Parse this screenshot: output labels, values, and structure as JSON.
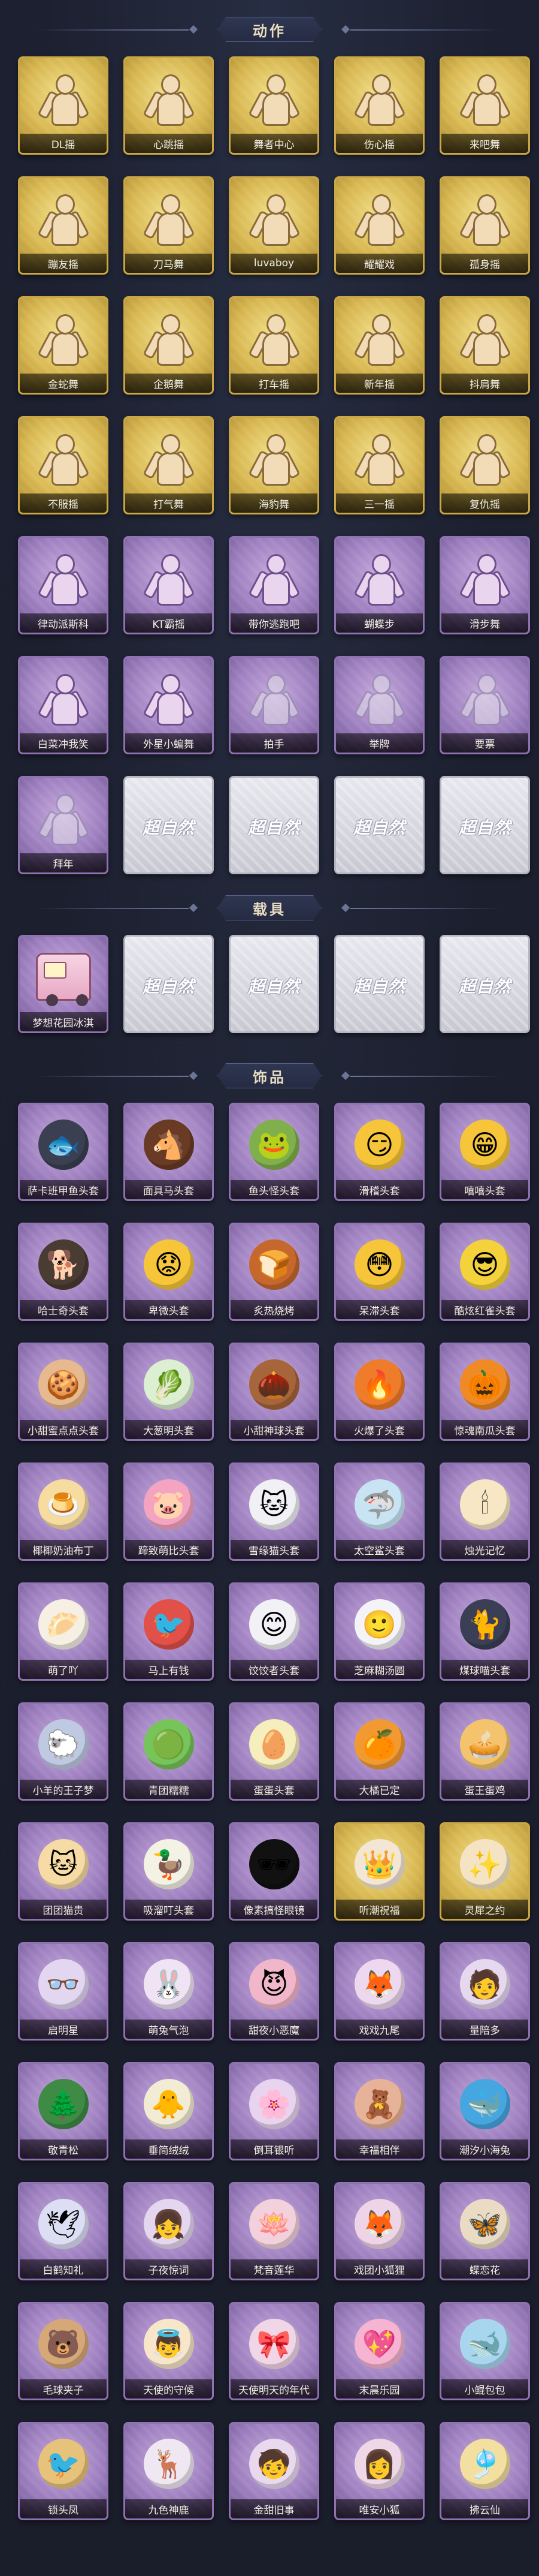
{
  "sections": [
    {
      "title": "动作",
      "items": [
        {
          "label": "DL摇",
          "style": "gold",
          "icon": "dance-figure-icon"
        },
        {
          "label": "心跳摇",
          "style": "gold",
          "icon": "dance-figure-icon"
        },
        {
          "label": "舞者中心",
          "style": "gold",
          "icon": "dance-figure-icon"
        },
        {
          "label": "伤心摇",
          "style": "gold",
          "icon": "dance-figure-icon"
        },
        {
          "label": "来吧舞",
          "style": "gold",
          "icon": "dance-figure-icon"
        },
        {
          "label": "蹦友摇",
          "style": "gold",
          "icon": "dance-figure-icon"
        },
        {
          "label": "刀马舞",
          "style": "gold",
          "icon": "dance-figure-icon"
        },
        {
          "label": "luvaboy",
          "style": "gold",
          "icon": "dance-figure-icon"
        },
        {
          "label": "耀耀戏",
          "style": "gold",
          "icon": "dance-figure-icon"
        },
        {
          "label": "孤身摇",
          "style": "gold",
          "icon": "dance-figure-icon"
        },
        {
          "label": "金蛇舞",
          "style": "gold",
          "icon": "dance-figure-icon"
        },
        {
          "label": "企鹅舞",
          "style": "gold",
          "icon": "dance-figure-icon"
        },
        {
          "label": "打车摇",
          "style": "gold",
          "icon": "dance-figure-icon"
        },
        {
          "label": "新年摇",
          "style": "gold",
          "icon": "dance-figure-icon"
        },
        {
          "label": "抖肩舞",
          "style": "gold",
          "icon": "dance-figure-icon"
        },
        {
          "label": "不服摇",
          "style": "gold",
          "icon": "dance-figure-icon"
        },
        {
          "label": "打气舞",
          "style": "gold",
          "icon": "dance-figure-icon"
        },
        {
          "label": "海豹舞",
          "style": "gold",
          "icon": "dance-figure-icon"
        },
        {
          "label": "三一摇",
          "style": "gold",
          "icon": "dance-figure-icon"
        },
        {
          "label": "复仇摇",
          "style": "gold",
          "icon": "dance-figure-icon"
        },
        {
          "label": "律动派斯科",
          "style": "purple",
          "icon": "dance-figure-icon"
        },
        {
          "label": "KT霸摇",
          "style": "purple",
          "icon": "dance-figure-icon"
        },
        {
          "label": "带你逃跑吧",
          "style": "purple",
          "icon": "dance-figure-icon"
        },
        {
          "label": "蝴蝶步",
          "style": "purple",
          "icon": "dance-figure-icon"
        },
        {
          "label": "滑步舞",
          "style": "purple",
          "icon": "dance-figure-icon"
        },
        {
          "label": "白菜冲我笑",
          "style": "purple",
          "icon": "dance-figure-icon"
        },
        {
          "label": "外星小蝙舞",
          "style": "purple",
          "icon": "dance-figure-icon"
        },
        {
          "label": "拍手",
          "style": "purple-faded",
          "icon": "dance-figure-icon"
        },
        {
          "label": "举牌",
          "style": "purple-faded",
          "icon": "dance-figure-icon"
        },
        {
          "label": "要票",
          "style": "purple-faded",
          "icon": "dance-figure-icon"
        },
        {
          "label": "拜年",
          "style": "purple-faded",
          "icon": "dance-figure-icon"
        },
        {
          "label": "",
          "style": "locked",
          "icon": "brand-watermark"
        },
        {
          "label": "",
          "style": "locked",
          "icon": "brand-watermark"
        },
        {
          "label": "",
          "style": "locked",
          "icon": "brand-watermark"
        },
        {
          "label": "",
          "style": "locked",
          "icon": "brand-watermark"
        }
      ]
    },
    {
      "title": "载具",
      "items": [
        {
          "label": "梦想花园冰淇",
          "style": "purple",
          "icon": "ice-cream-truck-icon"
        },
        {
          "label": "",
          "style": "locked",
          "icon": "brand-watermark"
        },
        {
          "label": "",
          "style": "locked",
          "icon": "brand-watermark"
        },
        {
          "label": "",
          "style": "locked",
          "icon": "brand-watermark"
        },
        {
          "label": "",
          "style": "locked",
          "icon": "brand-watermark"
        }
      ]
    },
    {
      "title": "饰品",
      "items": [
        {
          "label": "萨卡班甲鱼头套",
          "style": "purple",
          "icon": "fish-head-icon",
          "glyph": "🐟",
          "color": "#3b3f52"
        },
        {
          "label": "面具马头套",
          "style": "purple",
          "icon": "horse-head-icon",
          "glyph": "🐴",
          "color": "#6a3b24"
        },
        {
          "label": "鱼头怪头套",
          "style": "purple",
          "icon": "fish-monster-icon",
          "glyph": "🐸",
          "color": "#7fb04b"
        },
        {
          "label": "滑稽头套",
          "style": "purple",
          "icon": "smirk-face-icon",
          "glyph": "😏",
          "color": "#f6c53a"
        },
        {
          "label": "嘻嘻头套",
          "style": "purple",
          "icon": "grin-face-icon",
          "glyph": "😁",
          "color": "#f6c53a"
        },
        {
          "label": "哈士奇头套",
          "style": "purple",
          "icon": "husky-head-icon",
          "glyph": "🐕",
          "color": "#4a3b33"
        },
        {
          "label": "卑微头套",
          "style": "purple",
          "icon": "sad-face-icon",
          "glyph": "😟",
          "color": "#f6c53a"
        },
        {
          "label": "炙热烧烤",
          "style": "purple",
          "icon": "toast-head-icon",
          "glyph": "🍞",
          "color": "#c6682e"
        },
        {
          "label": "呆滞头套",
          "style": "purple",
          "icon": "dazed-face-icon",
          "glyph": "😳",
          "color": "#f6c53a"
        },
        {
          "label": "酷炫红雀头套",
          "style": "purple",
          "icon": "cool-bird-icon",
          "glyph": "😎",
          "color": "#f3d23c"
        },
        {
          "label": "小甜蜜点点头套",
          "style": "purple",
          "icon": "cookie-face-icon",
          "glyph": "🍪",
          "color": "#e7b98f"
        },
        {
          "label": "大葱明头套",
          "style": "purple",
          "icon": "scallion-icon",
          "glyph": "🥬",
          "color": "#dcefd2"
        },
        {
          "label": "小甜神球头套",
          "style": "purple",
          "icon": "acorn-head-icon",
          "glyph": "🌰",
          "color": "#a6653a"
        },
        {
          "label": "火爆了头套",
          "style": "purple",
          "icon": "fire-icon",
          "glyph": "🔥",
          "color": "#ef7c2a"
        },
        {
          "label": "惊魂南瓜头套",
          "style": "purple",
          "icon": "pumpkin-icon",
          "glyph": "🎃",
          "color": "#ef8a24"
        },
        {
          "label": "椰椰奶油布丁",
          "style": "purple",
          "icon": "pudding-icon",
          "glyph": "🍮",
          "color": "#f7dca0"
        },
        {
          "label": "蹄致萌比头套",
          "style": "purple",
          "icon": "pink-pig-icon",
          "glyph": "🐷",
          "color": "#f4a4c1"
        },
        {
          "label": "雪缘猫头套",
          "style": "purple",
          "icon": "snow-cat-icon",
          "glyph": "🐱",
          "color": "#f1f1f5"
        },
        {
          "label": "太空鲨头套",
          "style": "purple",
          "icon": "space-shark-icon",
          "glyph": "🦈",
          "color": "#c8e4f4"
        },
        {
          "label": "烛光记忆",
          "style": "purple",
          "icon": "candle-icon",
          "glyph": "🕯",
          "color": "#f7e7c4"
        },
        {
          "label": "萌了吖",
          "style": "purple",
          "icon": "dumpling-icon",
          "glyph": "🥟",
          "color": "#f5efe4"
        },
        {
          "label": "马上有钱",
          "style": "purple",
          "icon": "red-bird-icon",
          "glyph": "🐦",
          "color": "#e2504a"
        },
        {
          "label": "饺饺者头套",
          "style": "purple",
          "icon": "dumpling-face-icon",
          "glyph": "😊",
          "color": "#f2f2f6"
        },
        {
          "label": "芝麻糊汤圆",
          "style": "purple",
          "icon": "rice-ball-icon",
          "glyph": "🙂",
          "color": "#f4f4f8"
        },
        {
          "label": "煤球喵头套",
          "style": "purple",
          "icon": "black-cat-icon",
          "glyph": "🐈",
          "color": "#3b3f55"
        },
        {
          "label": "小羊的王子梦",
          "style": "purple",
          "icon": "sheep-prince-icon",
          "glyph": "🐑",
          "color": "#bfc9e1"
        },
        {
          "label": "青团糯糯",
          "style": "purple",
          "icon": "green-bun-icon",
          "glyph": "🟢",
          "color": "#77c45a"
        },
        {
          "label": "蛋蛋头套",
          "style": "purple",
          "icon": "egg-face-icon",
          "glyph": "🥚",
          "color": "#f6eebc"
        },
        {
          "label": "大橘已定",
          "style": "purple",
          "icon": "orange-face-icon",
          "glyph": "🍊",
          "color": "#f29a32"
        },
        {
          "label": "蛋王蛋鸡",
          "style": "purple",
          "icon": "egg-tart-icon",
          "glyph": "🥧",
          "color": "#f3c46d"
        },
        {
          "label": "团团猫贵",
          "style": "purple",
          "icon": "lucky-cat-icon",
          "glyph": "🐱",
          "color": "#f6dba4"
        },
        {
          "label": "吸溜叮头套",
          "style": "purple",
          "icon": "duck-head-icon",
          "glyph": "🦆",
          "color": "#f4f2e4"
        },
        {
          "label": "像素搞怪眼镜",
          "style": "dark",
          "icon": "pixel-sunglasses-icon",
          "glyph": "🕶",
          "color": "#111111"
        },
        {
          "label": "听潮祝福",
          "style": "gold",
          "icon": "pearl-tiara-icon",
          "glyph": "👑",
          "color": "#f3e6d4"
        },
        {
          "label": "灵犀之约",
          "style": "gold",
          "icon": "hair-ornament-icon",
          "glyph": "✨",
          "color": "#f5e4c4"
        },
        {
          "label": "启明星",
          "style": "purple",
          "icon": "star-glasses-icon",
          "glyph": "👓",
          "color": "#e2d6f0"
        },
        {
          "label": "萌兔气泡",
          "style": "purple",
          "icon": "bunny-bubble-icon",
          "glyph": "🐰",
          "color": "#f0e4f4"
        },
        {
          "label": "甜夜小恶魔",
          "style": "purple",
          "icon": "little-devil-icon",
          "glyph": "😈",
          "color": "#f1b6ca"
        },
        {
          "label": "戏戏九尾",
          "style": "purple",
          "icon": "nine-tail-fox-icon",
          "glyph": "🦊",
          "color": "#eed8ef"
        },
        {
          "label": "量陪多",
          "style": "purple",
          "icon": "character-figure-icon",
          "glyph": "🧑",
          "color": "#e6d8ef"
        },
        {
          "label": "敬青松",
          "style": "purple",
          "icon": "bonsai-icon",
          "glyph": "🌲",
          "color": "#3f8a45"
        },
        {
          "label": "垂简绒绒",
          "style": "purple",
          "icon": "fluffy-plush-icon",
          "glyph": "🐥",
          "color": "#f3ecd4"
        },
        {
          "label": "倒耳银听",
          "style": "purple",
          "icon": "lotus-ear-icon",
          "glyph": "🌸",
          "color": "#e8d4ef"
        },
        {
          "label": "幸福相伴",
          "style": "purple",
          "icon": "tea-party-icon",
          "glyph": "🧸",
          "color": "#e7b398"
        },
        {
          "label": "潮汐小海兔",
          "style": "purple",
          "icon": "sea-bunny-icon",
          "glyph": "🐳",
          "color": "#46a6e0"
        },
        {
          "label": "白鹤知礼",
          "style": "purple",
          "icon": "white-crane-icon",
          "glyph": "🕊",
          "color": "#dcdff3"
        },
        {
          "label": "子夜惊词",
          "style": "purple",
          "icon": "night-girl-icon",
          "glyph": "👧",
          "color": "#e4d6ef"
        },
        {
          "label": "梵音莲华",
          "style": "purple",
          "icon": "lotus-girl-icon",
          "glyph": "🪷",
          "color": "#f2d0dc"
        },
        {
          "label": "戏团小狐狸",
          "style": "purple",
          "icon": "circus-fox-icon",
          "glyph": "🦊",
          "color": "#eed4e6"
        },
        {
          "label": "蝶恋花",
          "style": "purple",
          "icon": "butterfly-icon",
          "glyph": "🦋",
          "color": "#eadcc4"
        },
        {
          "label": "毛球夹子",
          "style": "purple",
          "icon": "pompom-clip-icon",
          "glyph": "🐻",
          "color": "#d6a878"
        },
        {
          "label": "天使的守候",
          "style": "purple",
          "icon": "angel-icon",
          "glyph": "👼",
          "color": "#f7e6c9"
        },
        {
          "label": "天使明天的年代",
          "style": "purple",
          "icon": "angel-girl-icon",
          "glyph": "🎀",
          "color": "#f1d6e8"
        },
        {
          "label": "末晨乐园",
          "style": "purple",
          "icon": "pink-girl-icon",
          "glyph": "💖",
          "color": "#f6b4d2"
        },
        {
          "label": "小鲲包包",
          "style": "purple",
          "icon": "whale-bag-icon",
          "glyph": "🐋",
          "color": "#a9d6ef"
        },
        {
          "label": "锁头凤",
          "style": "purple",
          "icon": "phoenix-icon",
          "glyph": "🐦",
          "color": "#e7c27a"
        },
        {
          "label": "九色神鹿",
          "style": "purple",
          "icon": "deer-icon",
          "glyph": "🦌",
          "color": "#efe8f2"
        },
        {
          "label": "金甜旧事",
          "style": "purple",
          "icon": "boy-figure-icon",
          "glyph": "🧒",
          "color": "#e8d9ef"
        },
        {
          "label": "唯安小狐",
          "style": "purple",
          "icon": "girl-figure-icon",
          "glyph": "👩",
          "color": "#eed8e8"
        },
        {
          "label": "拂云仙",
          "style": "purple",
          "icon": "cloud-fairy-icon",
          "glyph": "🎐",
          "color": "#f3dfa0"
        }
      ]
    }
  ],
  "locked_watermark": "超自然"
}
